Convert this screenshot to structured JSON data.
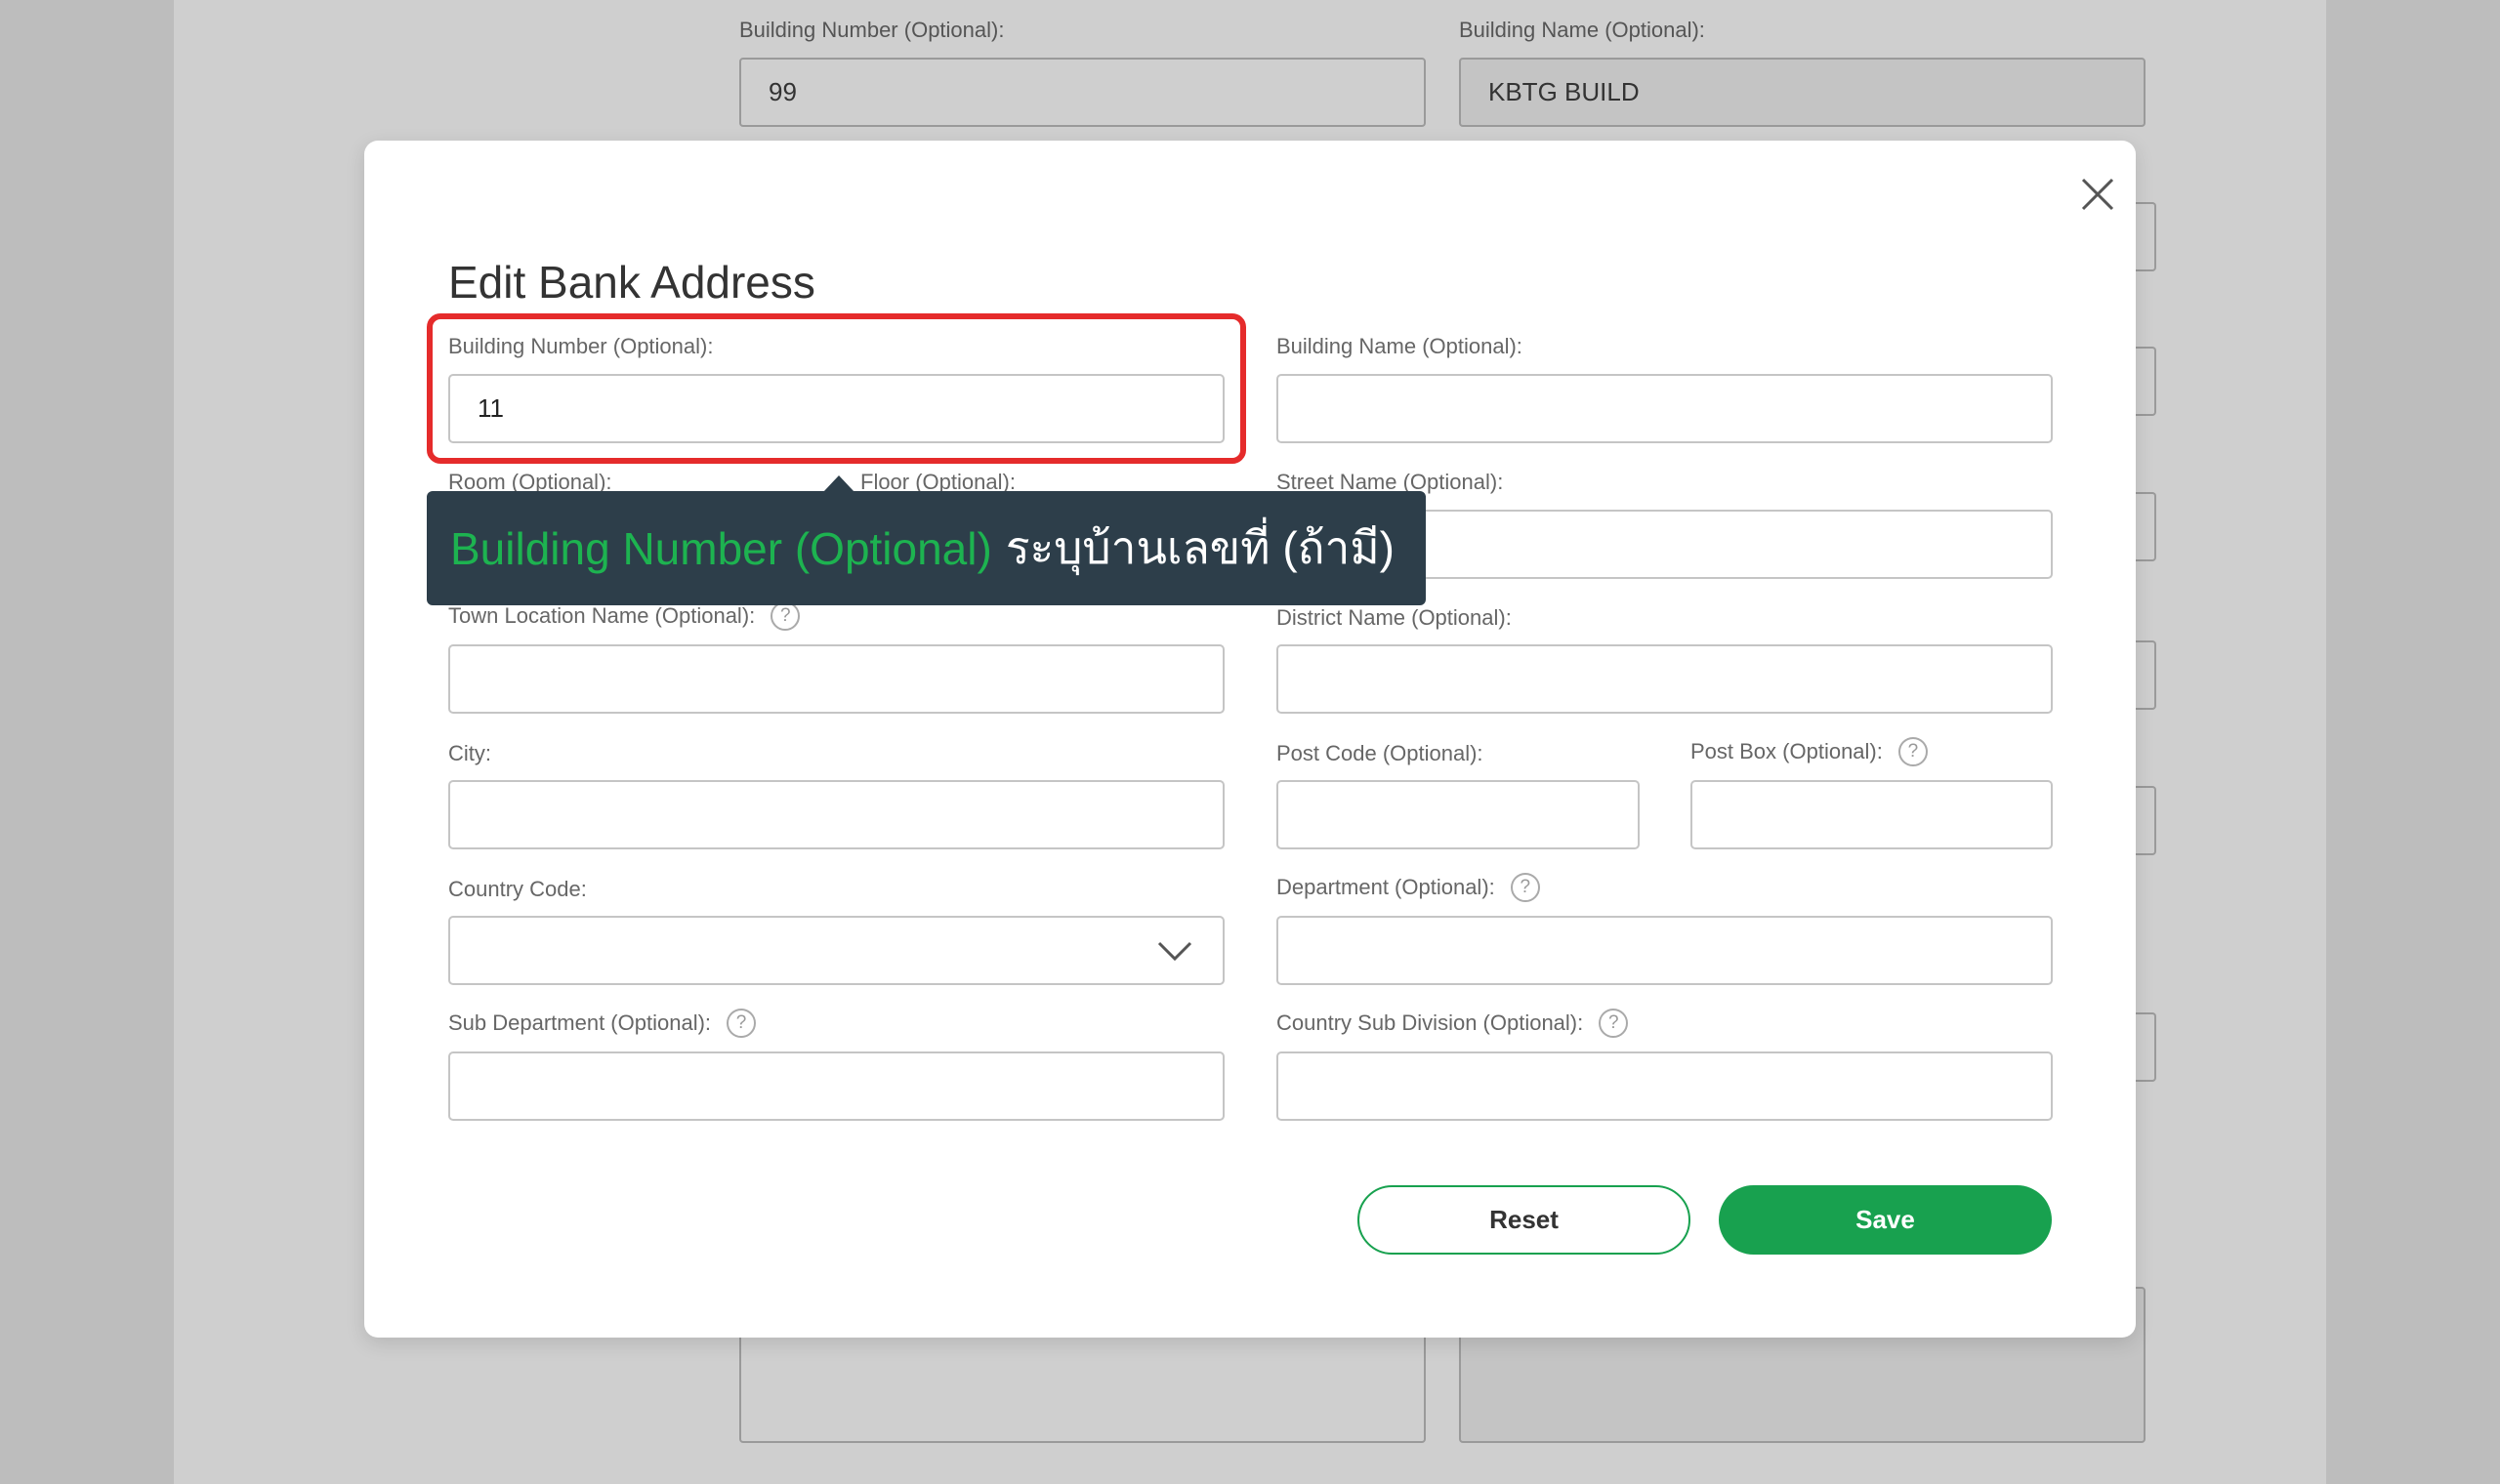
{
  "background_form": {
    "building_number_label": "Building Number (Optional):",
    "building_number_value": "99",
    "building_name_label": "Building Name (Optional):",
    "building_name_value": "KBTG BUILD"
  },
  "modal": {
    "title": "Edit Bank Address",
    "fields": {
      "building_number": {
        "label": "Building Number (Optional):",
        "value": "11"
      },
      "building_name": {
        "label": "Building Name (Optional):",
        "value": ""
      },
      "room": {
        "label": "Room (Optional):"
      },
      "floor": {
        "label": "Floor (Optional):"
      },
      "street_name": {
        "label": "Street Name (Optional):",
        "value": ""
      },
      "town_location": {
        "label": "Town Location Name (Optional):",
        "value": ""
      },
      "district_name": {
        "label": "District Name (Optional):",
        "value": ""
      },
      "city": {
        "label": "City:",
        "value": ""
      },
      "post_code": {
        "label": "Post Code (Optional):",
        "value": ""
      },
      "post_box": {
        "label": "Post Box (Optional):",
        "value": ""
      },
      "country_code": {
        "label": "Country Code:",
        "value": ""
      },
      "department": {
        "label": "Department (Optional):",
        "value": ""
      },
      "sub_department": {
        "label": "Sub Department (Optional):",
        "value": ""
      },
      "country_sub_division": {
        "label": "Country Sub Division (Optional):",
        "value": ""
      }
    },
    "help_glyph": "?",
    "buttons": {
      "reset": "Reset",
      "save": "Save"
    }
  },
  "tooltip": {
    "highlight_text": "Building Number (Optional)",
    "thai_text": "ระบุบ้านเลขที่ (ถ้ามี)"
  },
  "colors": {
    "accent": "#18a14f",
    "highlight": "#e52b2b",
    "tooltip_bg": "#2d3e4a"
  }
}
